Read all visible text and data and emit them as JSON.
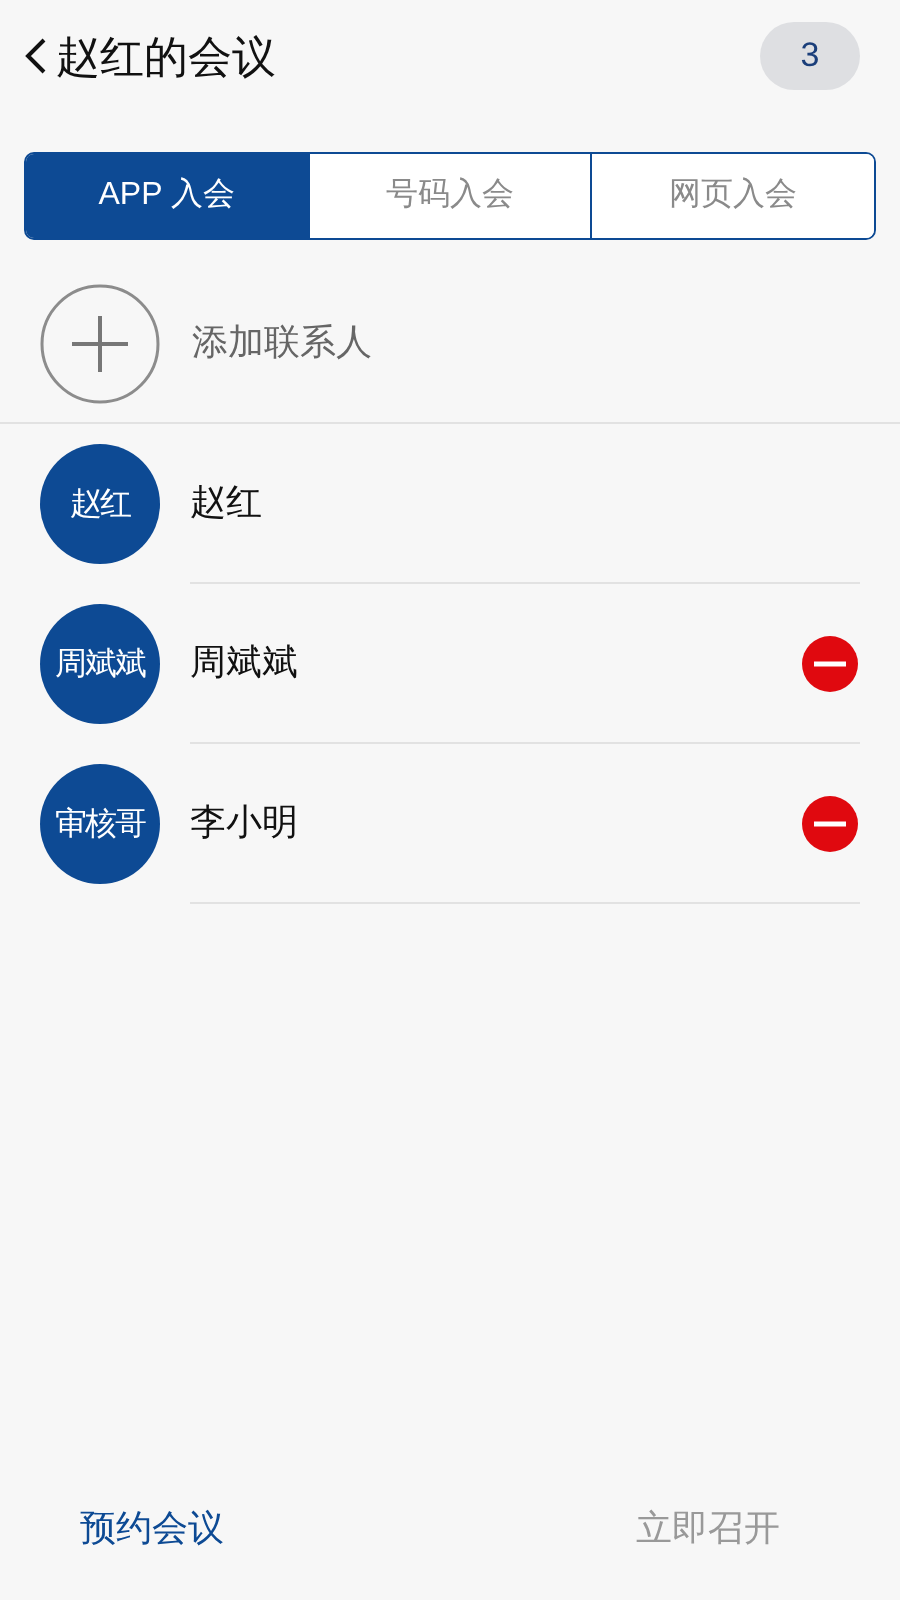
{
  "header": {
    "title": "赵红的会议",
    "count": "3"
  },
  "tabs": [
    {
      "label": "APP 入会",
      "selected": true
    },
    {
      "label": "号码入会",
      "selected": false
    },
    {
      "label": "网页入会",
      "selected": false
    }
  ],
  "add_contact": {
    "label": "添加联系人"
  },
  "participants": [
    {
      "avatar": "赵红",
      "name": "赵红",
      "removable": false
    },
    {
      "avatar": "周斌斌",
      "name": "周斌斌",
      "removable": true
    },
    {
      "avatar": "审核哥",
      "name": "李小明",
      "removable": true
    }
  ],
  "footer": {
    "schedule": "预约会议",
    "start": "立即召开"
  }
}
